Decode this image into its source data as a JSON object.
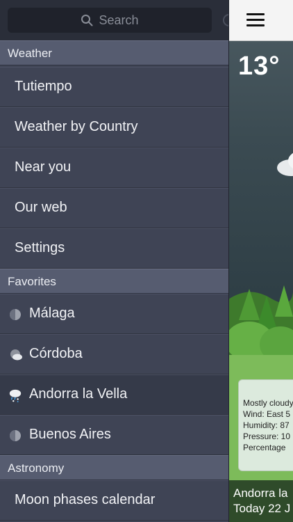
{
  "search": {
    "placeholder": "Search"
  },
  "sections": {
    "weather": "Weather",
    "favorites": "Favorites",
    "astronomy": "Astronomy"
  },
  "menu": {
    "tutiempo": "Tutiempo",
    "weather_by_country": "Weather by Country",
    "near_you": "Near you",
    "our_web": "Our web",
    "settings": "Settings",
    "moon_phases": "Moon phases calendar"
  },
  "favorites": [
    {
      "name": "Málaga",
      "icon": "sun-dim-icon"
    },
    {
      "name": "Córdoba",
      "icon": "partly-cloudy-icon"
    },
    {
      "name": "Andorra la Vella",
      "icon": "snow-rain-icon",
      "selected": true
    },
    {
      "name": "Buenos Aires",
      "icon": "sun-dim-icon"
    }
  ],
  "weather": {
    "temperature": "13°",
    "details": [
      "Mostly cloudy",
      "Wind: East 5",
      "Humidity: 87",
      "Pressure: 10",
      "Percentage"
    ],
    "location": "Andorra la",
    "date": "Today 22 J"
  }
}
